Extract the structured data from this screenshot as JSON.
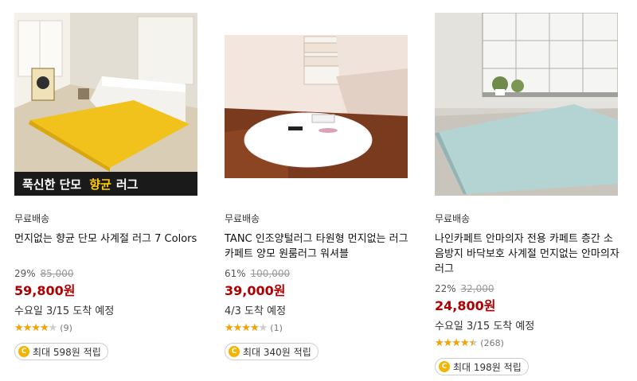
{
  "products": [
    {
      "image": "yellow-rug-bedroom-photo",
      "banner": {
        "part1": "푹신한 단모",
        "highlight": "향균",
        "part2": "러그"
      },
      "shipping": "무료배송",
      "title": "먼지없는 향균 단모 사계절 러그 7 Colors",
      "discount": "29%",
      "original_price": "85,000",
      "price": "59,800원",
      "arrival": "수요일 3/15 도착 예정",
      "rating": 4.0,
      "review_count": "(9)",
      "reward": "최대 598원 적립"
    },
    {
      "image": "white-fur-rug-photo",
      "shipping": "무료배송",
      "title": "TANC 인조양털러그 타원형 먼지없는 러그 카페트 양모 원룸러그 워셔블",
      "discount": "61%",
      "original_price": "100,000",
      "price": "39,000원",
      "arrival": "4/3 도착 예정",
      "rating": 4.0,
      "review_count": "(1)",
      "reward": "최대 340원 적립"
    },
    {
      "image": "mint-rug-window-photo",
      "shipping": "무료배송",
      "title": "나인카페트 안마의자 전용 카페트 층간 소음방지 바닥보호 사계절 먼지없는 안마의자 러그",
      "discount": "22%",
      "original_price": "32,000",
      "price": "24,800원",
      "arrival": "수요일 3/15 도착 예정",
      "rating": 4.5,
      "review_count": "(268)",
      "reward": "최대 198원 적립"
    }
  ],
  "icons": {
    "star": "star-icon",
    "coin": "cash-coin-icon"
  },
  "coin_glyph": "C",
  "colors": {
    "price": "#ae0000",
    "star": "#f5a300",
    "coin": "#f5b400"
  }
}
